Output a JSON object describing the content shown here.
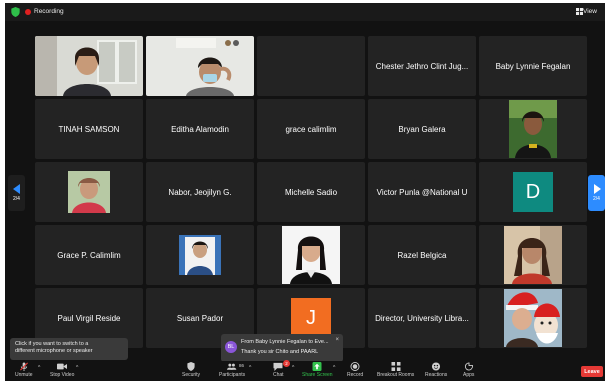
{
  "topbar": {
    "recording_label": "Recording",
    "view_label": "View"
  },
  "pagination": {
    "left_page": "2/4",
    "right_page": "2/4"
  },
  "tiles": [
    {
      "name": "",
      "kind": "video"
    },
    {
      "name": "",
      "kind": "video"
    },
    {
      "name": "",
      "kind": "empty"
    },
    {
      "name": "Chester Jethro Clint Jug...",
      "kind": "name"
    },
    {
      "name": "Baby Lynnie Fegalan",
      "kind": "name"
    },
    {
      "name": "TINAH SAMSON",
      "kind": "name"
    },
    {
      "name": "Editha Alamodin",
      "kind": "name"
    },
    {
      "name": "grace calimlim",
      "kind": "name"
    },
    {
      "name": "Bryan Galera",
      "kind": "name"
    },
    {
      "name": "",
      "kind": "photo"
    },
    {
      "name": "",
      "kind": "photo"
    },
    {
      "name": "Nabor, Jeojilyn G.",
      "kind": "name"
    },
    {
      "name": "Michelle Sadio",
      "kind": "name"
    },
    {
      "name": "Victor Punla @National U",
      "kind": "name"
    },
    {
      "name": "",
      "kind": "avatar",
      "avatar_letter": "D",
      "avatar_color": "#0e8a80"
    },
    {
      "name": "Grace P. Calimlim",
      "kind": "name"
    },
    {
      "name": "",
      "kind": "photo"
    },
    {
      "name": "",
      "kind": "photo"
    },
    {
      "name": "Razel Belgica",
      "kind": "name"
    },
    {
      "name": "",
      "kind": "photo"
    },
    {
      "name": "Paul Virgil Reside",
      "kind": "name"
    },
    {
      "name": "Susan Pador",
      "kind": "name"
    },
    {
      "name": "",
      "kind": "avatar",
      "avatar_letter": "J",
      "avatar_color": "#f26d21"
    },
    {
      "name": "Director, University Libra...",
      "kind": "name"
    },
    {
      "name": "",
      "kind": "photo"
    }
  ],
  "tooltip": {
    "line1": "Click if you want to switch to a",
    "line2": "different microphone or speaker"
  },
  "chat_popup": {
    "initials": "BL",
    "header": "From Baby Lynnie Fegalan to Eve...",
    "message": "Thank you sir Chito and PAARL",
    "close": "×"
  },
  "toolbar": {
    "unmute": "Unmute",
    "stop_video": "Stop Video",
    "security": "Security",
    "participants": "Participants",
    "participants_count": "86",
    "chat": "Chat",
    "chat_badge": "2",
    "share_screen": "Share Screen",
    "record": "Record",
    "breakout_rooms": "Breakout Rooms",
    "reactions": "Reactions",
    "apps": "Apps",
    "leave": "Leave"
  },
  "colors": {
    "accent": "#2d8cff",
    "recording": "#e02020",
    "share": "#33c24d",
    "leave": "#e53935"
  }
}
